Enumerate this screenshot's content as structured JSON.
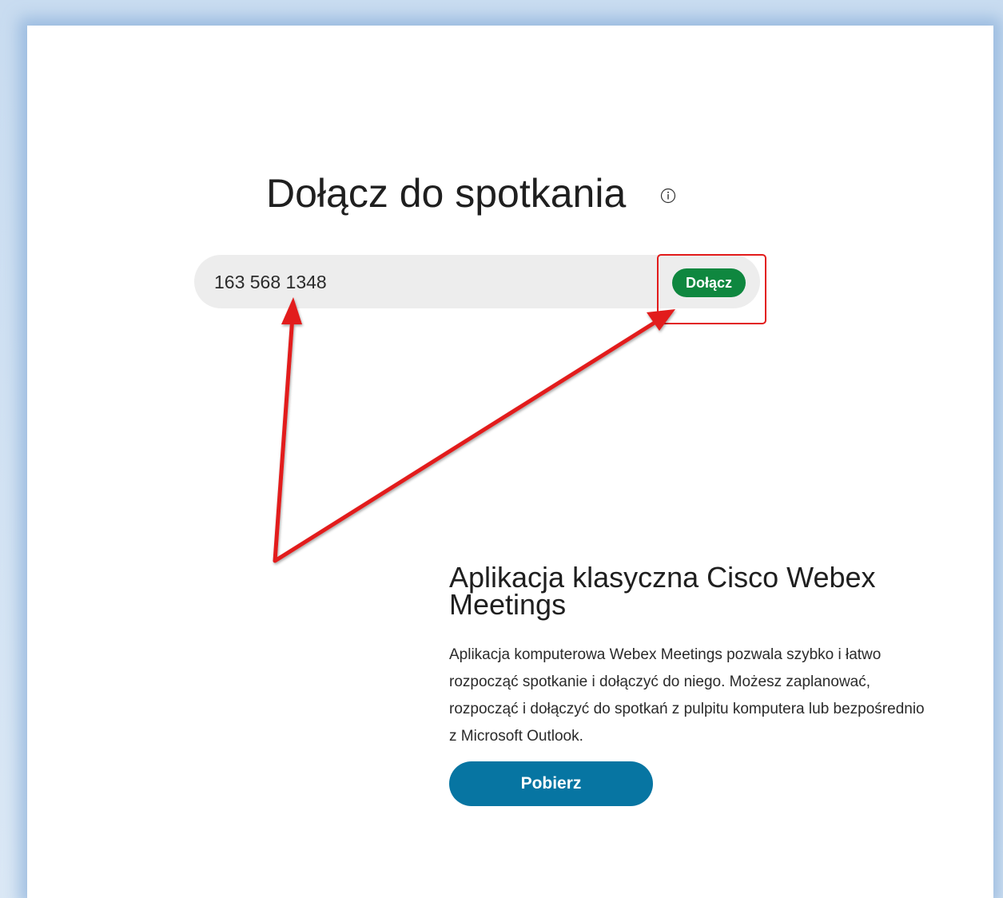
{
  "join": {
    "title": "Dołącz do spotkania",
    "meeting_number": "163 568 1348",
    "join_button_label": "Dołącz"
  },
  "desktop_app": {
    "heading": "Aplikacja klasyczna Cisco Webex Meetings",
    "description": "Aplikacja komputerowa Webex Meetings pozwala szybko i łatwo rozpocząć spotkanie i dołączyć do niego. Możesz zaplanować, rozpocząć i dołączyć do spotkań z pulpitu komputera lub bezpośrednio z Microsoft Outlook.",
    "download_button_label": "Pobierz"
  },
  "colors": {
    "join_button": "#0f873f",
    "download_button": "#0775a2",
    "annotation": "#e21b1b",
    "input_background": "#ededed"
  },
  "icons": {
    "info": "info-circle-icon"
  }
}
